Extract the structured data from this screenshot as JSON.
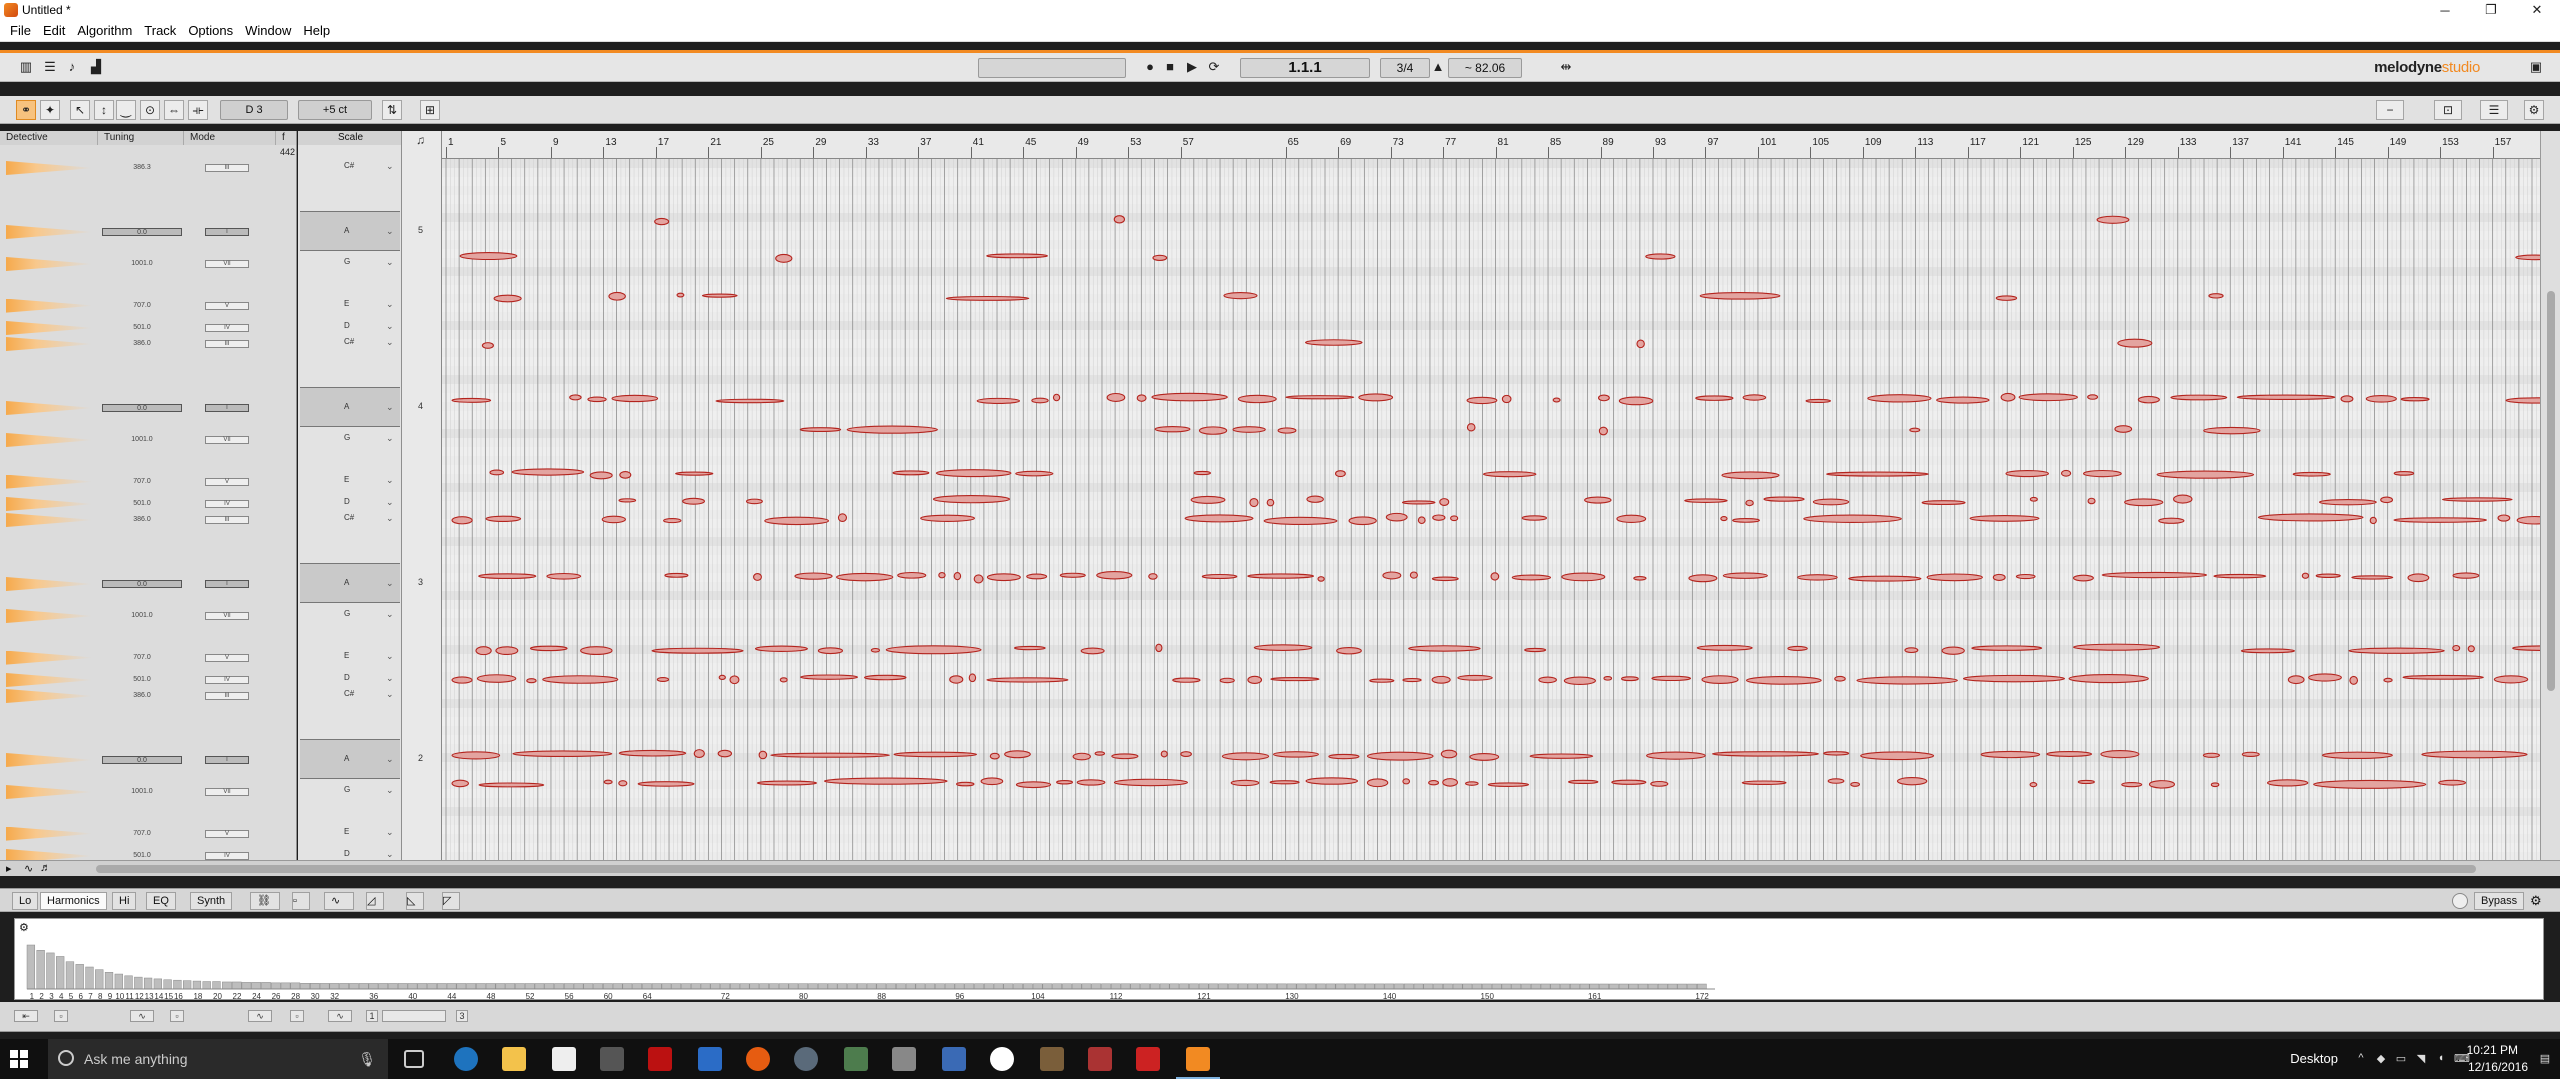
{
  "window": {
    "title": "Untitled *",
    "minimize": "─",
    "maximize": "❐",
    "close": "✕"
  },
  "menu": [
    "File",
    "Edit",
    "Algorithm",
    "Track",
    "Options",
    "Window",
    "Help"
  ],
  "transport": {
    "position": "1.1.1",
    "time_signature": "3/4",
    "tempo": "~ 82.06"
  },
  "brand": {
    "name": "melodyne",
    "edition": "studio"
  },
  "tools": {
    "pitch_field": "D 3",
    "cents_field": "+5 ct"
  },
  "left_panel": {
    "headers": [
      "Detective",
      "Tuning",
      "Mode",
      "Scale"
    ],
    "ref_value": "442",
    "rows": [
      {
        "val": "386.3",
        "mode": "III"
      },
      {
        "val": "0.0",
        "mode": "I",
        "strong": true
      },
      {
        "val": "1001.0",
        "mode": "VII"
      },
      {
        "val": "707.0",
        "mode": "V"
      },
      {
        "val": "501.0",
        "mode": "IV"
      },
      {
        "val": "386.0",
        "mode": "III"
      },
      {
        "val": "0.0",
        "mode": "I",
        "strong": true
      },
      {
        "val": "1001.0",
        "mode": "VII"
      },
      {
        "val": "707.0",
        "mode": "V"
      },
      {
        "val": "501.0",
        "mode": "IV"
      },
      {
        "val": "386.0",
        "mode": "III"
      },
      {
        "val": "0.0",
        "mode": "I",
        "strong": true
      },
      {
        "val": "1001.0",
        "mode": "VII"
      },
      {
        "val": "707.0",
        "mode": "V"
      },
      {
        "val": "501.0",
        "mode": "IV"
      },
      {
        "val": "386.0",
        "mode": "III"
      },
      {
        "val": "0.0",
        "mode": "I",
        "strong": true
      },
      {
        "val": "1001.0",
        "mode": "VII"
      },
      {
        "val": "707.0",
        "mode": "V"
      },
      {
        "val": "501.0",
        "mode": "IV"
      }
    ]
  },
  "scale_notes": [
    {
      "note": "C#",
      "octave": ""
    },
    {
      "note": "A",
      "octave": "5",
      "root": true
    },
    {
      "note": "G",
      "octave": ""
    },
    {
      "note": "E",
      "octave": ""
    },
    {
      "note": "D",
      "octave": ""
    },
    {
      "note": "C#",
      "octave": ""
    },
    {
      "note": "A",
      "octave": "4",
      "root": true
    },
    {
      "note": "G",
      "octave": ""
    },
    {
      "note": "E",
      "octave": ""
    },
    {
      "note": "D",
      "octave": ""
    },
    {
      "note": "C#",
      "octave": ""
    },
    {
      "note": "A",
      "octave": "3",
      "root": true
    },
    {
      "note": "G",
      "octave": ""
    },
    {
      "note": "E",
      "octave": ""
    },
    {
      "note": "D",
      "octave": ""
    },
    {
      "note": "C#",
      "octave": ""
    },
    {
      "note": "A",
      "octave": "2",
      "root": true
    },
    {
      "note": "G",
      "octave": ""
    },
    {
      "note": "E",
      "octave": ""
    },
    {
      "note": "D",
      "octave": ""
    }
  ],
  "ruler_bars": [
    "1",
    "5",
    "9",
    "13",
    "17",
    "21",
    "25",
    "29",
    "33",
    "37",
    "41",
    "45",
    "49",
    "53",
    "57",
    "65",
    "69",
    "73",
    "77",
    "81",
    "85",
    "89",
    "93",
    "97",
    "101",
    "105",
    "109",
    "113",
    "117",
    "121",
    "125",
    "129",
    "133",
    "137",
    "141",
    "145",
    "149",
    "153",
    "157"
  ],
  "bottom_tabs": [
    "Lo",
    "Harmonics",
    "Hi",
    "EQ",
    "Synth"
  ],
  "bypass_label": "Bypass",
  "harmonics": {
    "labels": [
      "1",
      "2",
      "3",
      "4",
      "5",
      "6",
      "7",
      "8",
      "9",
      "10",
      "11",
      "12",
      "13",
      "14",
      "15",
      "16",
      "18",
      "20",
      "22",
      "24",
      "26",
      "28",
      "30",
      "32",
      "36",
      "40",
      "44",
      "48",
      "52",
      "56",
      "60",
      "64",
      "72",
      "80",
      "88",
      "96",
      "104",
      "112",
      "121",
      "130",
      "140",
      "150",
      "161",
      "172"
    ],
    "levels": [
      1.0,
      0.88,
      0.82,
      0.74,
      0.62,
      0.56,
      0.5,
      0.44,
      0.38,
      0.34,
      0.3,
      0.27,
      0.25,
      0.23,
      0.21,
      0.2,
      0.19,
      0.18,
      0.17,
      0.17,
      0.16,
      0.16,
      0.15,
      0.15,
      0.15,
      0.14,
      0.14,
      0.14,
      0.13,
      0.13
    ]
  },
  "bottom_controls": {
    "num_1": "1",
    "num_3": "3"
  },
  "taskbar": {
    "search_placeholder": "Ask me anything",
    "desktop_label": "Desktop",
    "time": "10:21 PM",
    "date": "12/16/2016"
  },
  "colors": {
    "accent": "#f28a22",
    "blob_fill": "#e3a4a0",
    "blob_stroke": "#b3241e"
  }
}
